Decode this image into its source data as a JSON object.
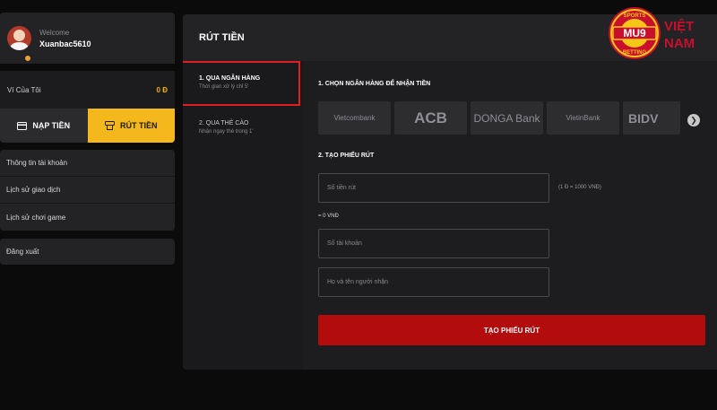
{
  "profile": {
    "welcome": "Welcome",
    "username": "Xuanbac5610"
  },
  "wallet": {
    "label": "Ví Của Tôi",
    "value": "0 Đ"
  },
  "actions": {
    "deposit": "NẠP TIỀN",
    "withdraw": "RÚT TIỀN"
  },
  "menu": [
    {
      "label": "Thông tin tài khoản"
    },
    {
      "label": "Lịch sử giao dịch"
    },
    {
      "label": "Lịch sử chơi game"
    }
  ],
  "logout": "Đăng xuất",
  "panel": {
    "title": "RÚT TIỀN"
  },
  "methods": [
    {
      "title": "1. QUA NGÂN HÀNG",
      "subtitle": "Thời gian xử lý chỉ 5'"
    },
    {
      "title": "2. QUA THẺ CÀO",
      "subtitle": "Nhận ngay thẻ trong 1'"
    }
  ],
  "section1": {
    "title": "1. CHỌN NGÂN HÀNG ĐỂ NHẬN TIỀN"
  },
  "banks": [
    "Vietcombank",
    "ACB",
    "DONGA Bank",
    "VietinBank",
    "BIDV"
  ],
  "section2": {
    "title": "2. TẠO PHIẾU RÚT"
  },
  "form": {
    "amount_placeholder": "Số tiền rút",
    "rate": "(1 Đ = 1000 VNĐ)",
    "converted": "= 0 VNĐ",
    "account_placeholder": "Số tài khoản",
    "name_placeholder": "Họ và tên người nhận",
    "submit": "TẠO PHIẾU RÚT"
  },
  "logo": {
    "brand": "MU9",
    "top_text": "SPORTS",
    "bottom_text": "BETTING",
    "country_line1": "VIỆT",
    "country_line2": "NAM"
  },
  "colors": {
    "accent": "#f5b81c",
    "danger": "#b30c0c",
    "highlight": "#e02020"
  }
}
